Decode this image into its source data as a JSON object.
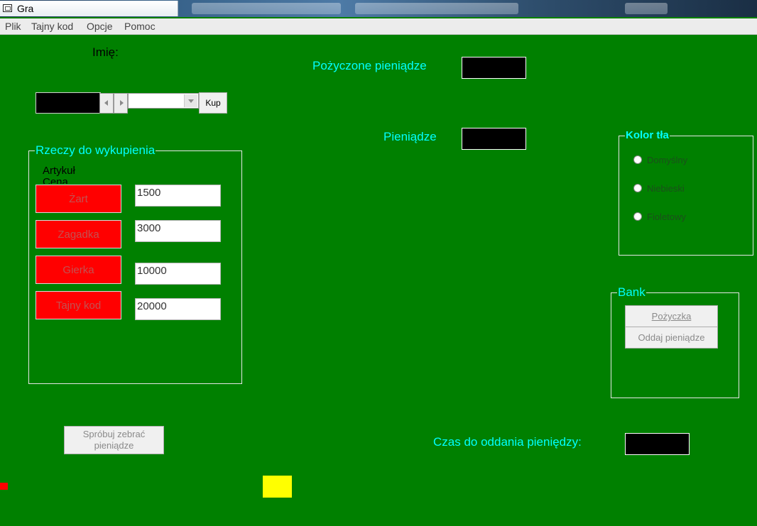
{
  "window": {
    "title": "Gra"
  },
  "menu": [
    "Plik",
    "Tajny kod",
    "Opcje",
    "Pomoc"
  ],
  "name": {
    "label": "Imię:"
  },
  "buy": {
    "combo_value": "",
    "button": "Kup"
  },
  "items_group": {
    "legend": "Rzeczy do wykupienia",
    "col_item": "Artykuł",
    "col_price": "Cena",
    "items": [
      {
        "name": "Żart",
        "price": "1500"
      },
      {
        "name": "Zagadka",
        "price": "3000"
      },
      {
        "name": "Gierka",
        "price": "10000"
      },
      {
        "name": "Tajny kod",
        "price": "20000"
      }
    ]
  },
  "borrowed": {
    "label": "Pożyczone pieniądze",
    "value": ""
  },
  "money": {
    "label": "Pieniądze",
    "value": ""
  },
  "bg_color": {
    "legend": "Kolor tła",
    "options": [
      "Domyślny",
      "Niebieski",
      "Fioletowy"
    ]
  },
  "bank": {
    "legend": "Bank",
    "loan_button": "Pożyczka",
    "repay_button": "Oddaj pieniądze"
  },
  "collect_button": {
    "line1": "Spróbuj zebrać",
    "line2": "pieniądze"
  },
  "time_to_repay": {
    "label": "Czas do oddania pieniędzy:",
    "value": ""
  },
  "colors": {
    "background": "#008000",
    "label_cyan": "#00ffff",
    "item_button": "#ff0000",
    "indicator_yellow": "#ffff00",
    "indicator_red": "#ff0000"
  }
}
